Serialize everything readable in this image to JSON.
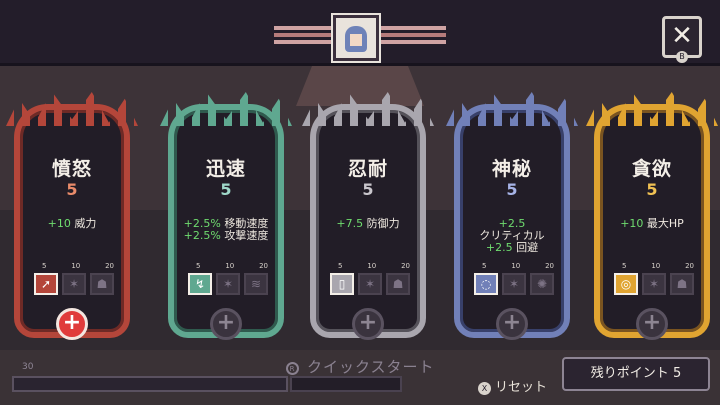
{
  "header": {
    "portrait_icon": "character-portrait-icon",
    "close_label": "✕",
    "close_hint": "B"
  },
  "cards": [
    {
      "name": "憤怒",
      "level": "5",
      "level_color": "#e98b6a",
      "frame_color": "#b4463a",
      "frame_inner": "#6e2a26",
      "stats": [
        {
          "value": "+10",
          "name": "威力"
        }
      ],
      "ticks": [
        "5",
        "10",
        "20"
      ],
      "slots": [
        {
          "icon": "➚",
          "active": true
        },
        {
          "icon": "✶",
          "active": false
        },
        {
          "icon": "☗",
          "active": false
        }
      ],
      "plus": "+",
      "plus_active": true
    },
    {
      "name": "迅速",
      "level": "5",
      "level_color": "#9fd8c9",
      "frame_color": "#5fa890",
      "frame_inner": "#2f5a4e",
      "stats": [
        {
          "value": "+2.5%",
          "name": "移動速度"
        },
        {
          "value": "+2.5%",
          "name": "攻撃速度"
        }
      ],
      "ticks": [
        "5",
        "10",
        "20"
      ],
      "slots": [
        {
          "icon": "↯",
          "active": true
        },
        {
          "icon": "✶",
          "active": false
        },
        {
          "icon": "≋",
          "active": false
        }
      ],
      "plus": "+",
      "plus_active": false
    },
    {
      "name": "忍耐",
      "level": "5",
      "level_color": "#c9c6cc",
      "frame_color": "#a9a6ae",
      "frame_inner": "#55525a",
      "stats": [
        {
          "value": "+7.5",
          "name": "防御力"
        }
      ],
      "ticks": [
        "5",
        "10",
        "20"
      ],
      "slots": [
        {
          "icon": "▯",
          "active": true
        },
        {
          "icon": "✶",
          "active": false
        },
        {
          "icon": "☗",
          "active": false
        }
      ],
      "plus": "+",
      "plus_active": false
    },
    {
      "name": "神秘",
      "level": "5",
      "level_color": "#a6b3e6",
      "frame_color": "#7180b8",
      "frame_inner": "#38406a",
      "stats": [
        {
          "value": "+2.5",
          "name": "クリティカル",
          "stacked": true
        },
        {
          "value": "+2.5",
          "name": "回避"
        }
      ],
      "ticks": [
        "5",
        "10",
        "20"
      ],
      "slots": [
        {
          "icon": "◌",
          "active": true
        },
        {
          "icon": "✶",
          "active": false
        },
        {
          "icon": "✺",
          "active": false
        }
      ],
      "plus": "+",
      "plus_active": false
    },
    {
      "name": "貪欲",
      "level": "5",
      "level_color": "#f0c153",
      "frame_color": "#e0a431",
      "frame_inner": "#7a5420",
      "stats": [
        {
          "value": "+10",
          "name": "最大HP"
        }
      ],
      "ticks": [
        "5",
        "10",
        "20"
      ],
      "slots": [
        {
          "icon": "◎",
          "active": true
        },
        {
          "icon": "✶",
          "active": false
        },
        {
          "icon": "☗",
          "active": false
        }
      ],
      "plus": "+",
      "plus_active": false
    }
  ],
  "footer": {
    "xp_value": "30",
    "quick_start_hint": "R",
    "quick_start_label": "クイックスタート",
    "reset_hint": "X",
    "reset_label": "リセット",
    "points_label": "残りポイント",
    "points_value": "5"
  }
}
